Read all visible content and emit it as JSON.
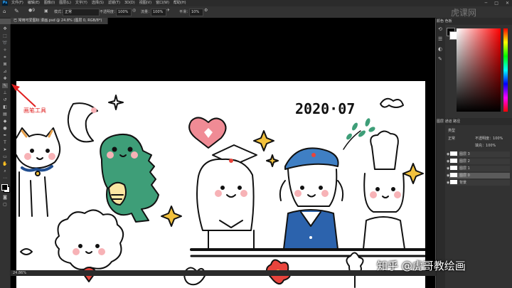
{
  "app": {
    "logo_text": "Ps"
  },
  "menubar": {
    "items": [
      "文件(F)",
      "编辑(E)",
      "图像(I)",
      "图层(L)",
      "文字(Y)",
      "选择(S)",
      "滤镜(T)",
      "3D(D)",
      "视图(V)",
      "窗口(W)",
      "帮助(H)"
    ]
  },
  "options": {
    "mode_label": "模式：",
    "mode_value": "正常",
    "opacity_label": "不透明度：",
    "opacity_value": "100%",
    "flow_label": "流量：",
    "flow_value": "100%",
    "smooth_label": "平滑：",
    "smooth_value": "10%",
    "brush_size": "9"
  },
  "document": {
    "tab_title": "已 常用可爱图标 漫画.psd @ 24.8% (图层 0, RGB/8*)",
    "zoom_status": "24.86%"
  },
  "annotation": {
    "label": "画笔工具",
    "color": "#e02020"
  },
  "artwork": {
    "date_text": "2020·07"
  },
  "panels": {
    "color_tabs": "颜色  色板",
    "layers_tabs": "图层  通道  路径",
    "kind_label": "类型",
    "opacity_label": "不透明度：",
    "opacity_value": "100%",
    "fill_label": "填充：",
    "fill_value": "100%",
    "layers": [
      "图层 3",
      "图层 2",
      "图层 1",
      "图层 0",
      "背景"
    ]
  },
  "watermark": {
    "text": "知乎 @虎哥教绘画",
    "top_text": "虎课网"
  },
  "colors": {
    "foreground": "#000000",
    "background": "#ffffff"
  }
}
